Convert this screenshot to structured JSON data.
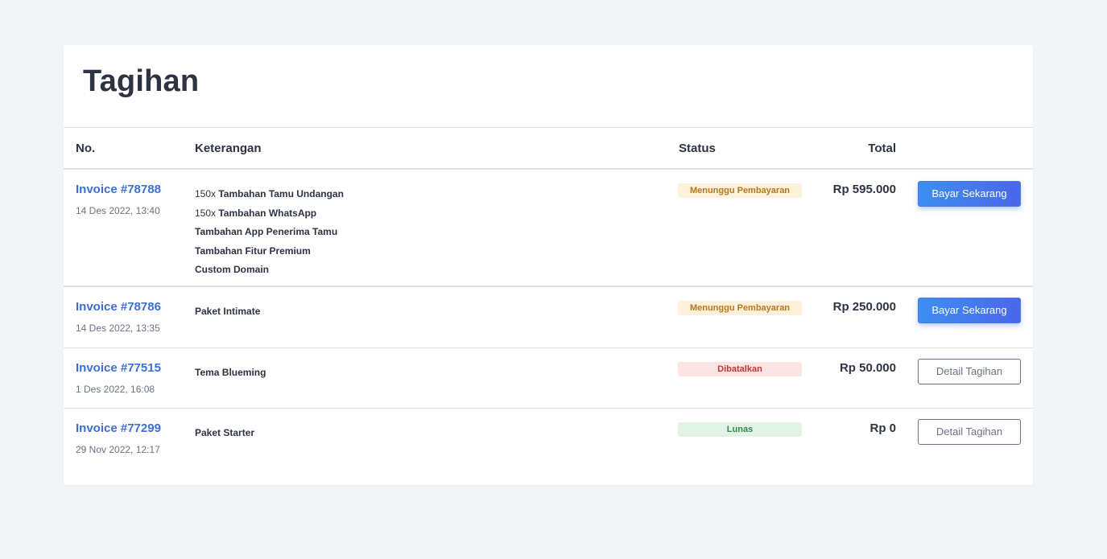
{
  "page": {
    "title": "Tagihan"
  },
  "table": {
    "headers": {
      "no": "No.",
      "keterangan": "Keterangan",
      "status": "Status",
      "total": "Total"
    },
    "rows": [
      {
        "invoice": "Invoice #78788",
        "date": "14 Des 2022, 13:40",
        "items": [
          {
            "qty": "150x ",
            "name": "Tambahan Tamu Undangan"
          },
          {
            "qty": "150x ",
            "name": "Tambahan WhatsApp"
          },
          {
            "qty": "",
            "name": "Tambahan App Penerima Tamu"
          },
          {
            "qty": "",
            "name": "Tambahan Fitur Premium"
          },
          {
            "qty": "",
            "name": "Custom Domain"
          }
        ],
        "status": "Menunggu Pembayaran",
        "status_type": "pending",
        "total": "Rp 595.000",
        "action": "Bayar Sekarang"
      },
      {
        "invoice": "Invoice #78786",
        "date": "14 Des 2022, 13:35",
        "items": [
          {
            "qty": "",
            "name": "Paket Intimate"
          }
        ],
        "status": "Menunggu Pembayaran",
        "status_type": "pending",
        "total": "Rp 250.000",
        "action": "Bayar Sekarang"
      },
      {
        "invoice": "Invoice #77515",
        "date": "1 Des 2022, 16:08",
        "items": [
          {
            "qty": "",
            "name": "Tema Blueming"
          }
        ],
        "status": "Dibatalkan",
        "status_type": "cancelled",
        "total": "Rp 50.000",
        "action": "Detail Tagihan"
      },
      {
        "invoice": "Invoice #77299",
        "date": "29 Nov 2022, 12:17",
        "items": [
          {
            "qty": "",
            "name": "Paket Starter"
          }
        ],
        "status": "Lunas",
        "status_type": "paid",
        "total": "Rp 0",
        "action": "Detail Tagihan"
      }
    ]
  },
  "colors": {
    "link": "#3b6fd4",
    "pending_bg": "#fdf1dc",
    "cancelled_bg": "#fce4e4",
    "paid_bg": "#e2f3e6",
    "primary_button": "#4a7ae6"
  }
}
